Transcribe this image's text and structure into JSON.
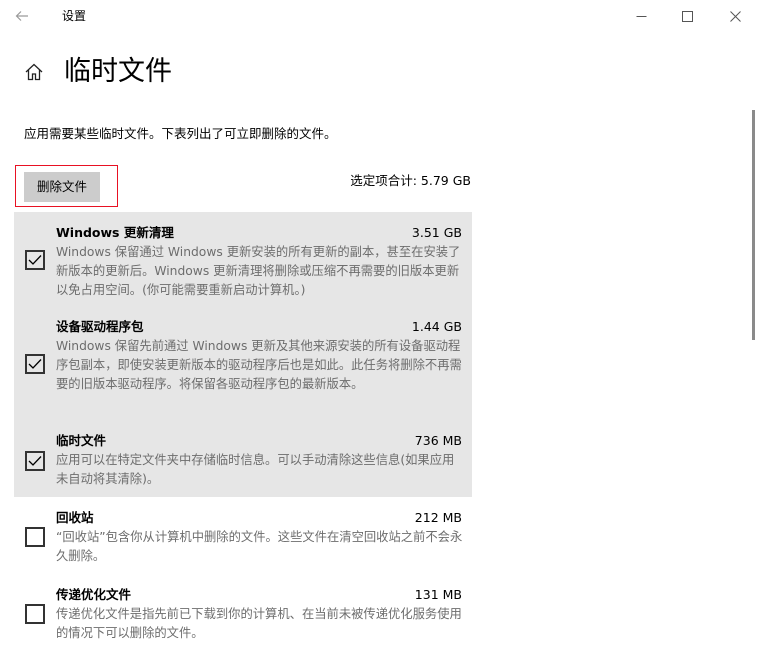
{
  "window": {
    "title": "设置"
  },
  "header": {
    "page_title": "临时文件",
    "description": "应用需要某些临时文件。下表列出了可立即删除的文件。"
  },
  "actions": {
    "delete_label": "删除文件",
    "total_label": "选定项合计:",
    "total_value": "5.79 GB"
  },
  "items": [
    {
      "title": "Windows 更新清理",
      "size": "3.51 GB",
      "checked": true,
      "description": "Windows 保留通过 Windows 更新安装的所有更新的副本，甚至在安装了新版本的更新后。Windows 更新清理将删除或压缩不再需要的旧版本更新以免占用空间。(你可能需要重新启动计算机。)"
    },
    {
      "title": "设备驱动程序包",
      "size": "1.44 GB",
      "checked": true,
      "description": "Windows 保留先前通过 Windows 更新及其他来源安装的所有设备驱动程序包副本，即使安装更新版本的驱动程序后也是如此。此任务将删除不再需要的旧版本驱动程序。将保留各驱动程序包的最新版本。"
    },
    {
      "title": "临时文件",
      "size": "736 MB",
      "checked": true,
      "description": "应用可以在特定文件夹中存储临时信息。可以手动清除这些信息(如果应用未自动将其清除)。"
    },
    {
      "title": "回收站",
      "size": "212 MB",
      "checked": false,
      "description": "“回收站”包含你从计算机中删除的文件。这些文件在清空回收站之前不会永久删除。"
    },
    {
      "title": "传递优化文件",
      "size": "131 MB",
      "checked": false,
      "description": "传递优化文件是指先前已下载到你的计算机、在当前未被传递优化服务使用的情况下可以删除的文件。"
    }
  ]
}
